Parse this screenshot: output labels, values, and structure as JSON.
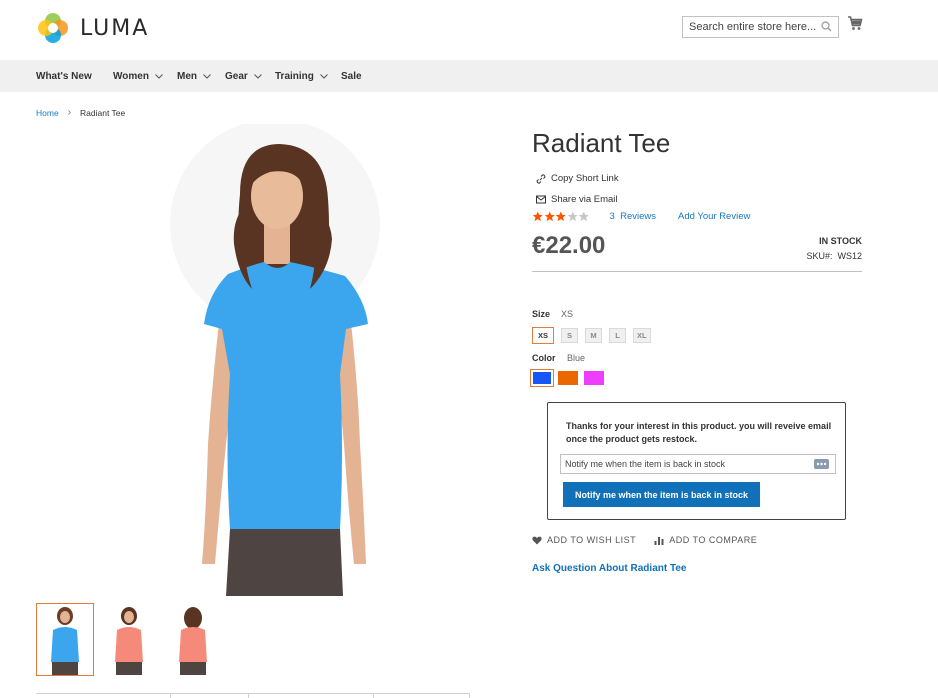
{
  "header": {
    "logo_text": "LUMA",
    "search_placeholder": "Search entire store here...",
    "cart_icon": "cart-icon"
  },
  "nav": {
    "items": [
      {
        "label": "What's New",
        "has_dropdown": false
      },
      {
        "label": "Women",
        "has_dropdown": true
      },
      {
        "label": "Men",
        "has_dropdown": true
      },
      {
        "label": "Gear",
        "has_dropdown": true
      },
      {
        "label": "Training",
        "has_dropdown": true
      },
      {
        "label": "Sale",
        "has_dropdown": false
      }
    ]
  },
  "breadcrumb": {
    "home": "Home",
    "separator": "›",
    "current": "Radiant Tee"
  },
  "product": {
    "title": "Radiant Tee",
    "copy_link": "Copy Short Link",
    "share_email": "Share via Email",
    "rating_stars": 3,
    "rating_max": 5,
    "reviews_count": "3",
    "reviews_label": "Reviews",
    "add_review": "Add Your Review",
    "price": "€22.00",
    "stock": "IN STOCK",
    "sku_label": "SKU#:",
    "sku": "WS12",
    "size_label": "Size",
    "size_selected": "XS",
    "sizes": [
      "XS",
      "S",
      "M",
      "L",
      "XL"
    ],
    "color_label": "Color",
    "color_selected": "Blue",
    "colors": [
      {
        "name": "Blue",
        "hex": "#1857f7"
      },
      {
        "name": "Orange",
        "hex": "#eb6703"
      },
      {
        "name": "Purple",
        "hex": "#ef3dff"
      }
    ]
  },
  "notify": {
    "message": "Thanks for your interest in this product. you will reveive email once the product gets restock.",
    "input_value": "Notify me when the item is back in stock",
    "button": "Notify me when the item is back in stock"
  },
  "actions": {
    "wishlist": "ADD TO WISH LIST",
    "compare": "ADD TO COMPARE",
    "ask": "Ask Question About Radiant Tee"
  },
  "colors": {
    "accent_blue": "#1070b8",
    "link_blue": "#1979c3",
    "star_orange": "#ff5501",
    "selected_border": "#e07b39",
    "nav_bg": "#f0f0f0"
  }
}
